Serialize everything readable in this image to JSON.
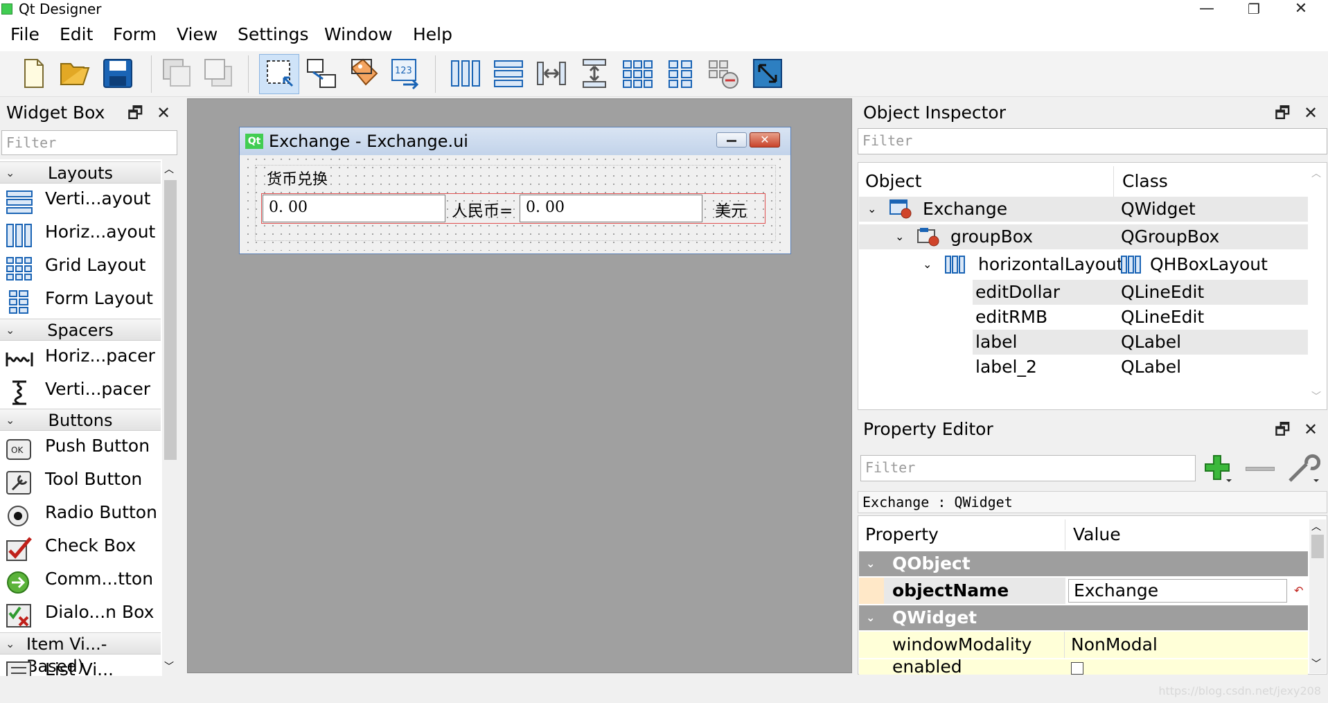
{
  "window": {
    "title": "Qt Designer",
    "minimize": "—",
    "maximize": "❐",
    "close": "✕"
  },
  "menu": [
    "File",
    "Edit",
    "Form",
    "View",
    "Settings",
    "Window",
    "Help"
  ],
  "widget_box": {
    "title": "Widget Box",
    "filter_placeholder": "Filter",
    "categories": {
      "layouts": "Layouts",
      "spacers": "Spacers",
      "buttons": "Buttons",
      "item_views": "Item Vi...-Based)"
    },
    "layouts": [
      "Verti...ayout",
      "Horiz...ayout",
      "Grid Layout",
      "Form Layout"
    ],
    "spacers": [
      "Horiz...pacer",
      "Verti...pacer"
    ],
    "buttons": [
      "Push Button",
      "Tool Button",
      "Radio Button",
      "Check Box",
      "Comm...tton",
      "Dialo...n Box"
    ],
    "partial_item": "List Vi..."
  },
  "form_window": {
    "badge": "Qt",
    "title": "Exchange - Exchange.ui",
    "group_title": "货币兑换",
    "edit_rmb": "0. 00",
    "label_rmb": "人民币=",
    "edit_dollar": "0. 00",
    "label_dollar": "美元"
  },
  "object_inspector": {
    "title": "Object Inspector",
    "filter_placeholder": "Filter",
    "col_object": "Object",
    "col_class": "Class",
    "rows": [
      {
        "object": "Exchange",
        "class": "QWidget"
      },
      {
        "object": "groupBox",
        "class": "QGroupBox"
      },
      {
        "object": "horizontalLayout",
        "class": "QHBoxLayout"
      },
      {
        "object": "editDollar",
        "class": "QLineEdit"
      },
      {
        "object": "editRMB",
        "class": "QLineEdit"
      },
      {
        "object": "label",
        "class": "QLabel"
      },
      {
        "object": "label_2",
        "class": "QLabel"
      }
    ]
  },
  "property_editor": {
    "title": "Property Editor",
    "filter_placeholder": "Filter",
    "context": "Exchange : QWidget",
    "col_property": "Property",
    "col_value": "Value",
    "group_qobject": "QObject",
    "prop_object_name": "objectName",
    "val_object_name": "Exchange",
    "group_qwidget": "QWidget",
    "prop_window_modality": "windowModality",
    "val_window_modality": "NonModal",
    "prop_enabled": "enabled"
  },
  "watermark": "https://blog.csdn.net/jexy208",
  "colors": {
    "accent_blue": "#1a64b5",
    "qt_green": "#41cd52",
    "group_gray": "#9e9e9e",
    "property_yellow": "#ffffd8"
  }
}
